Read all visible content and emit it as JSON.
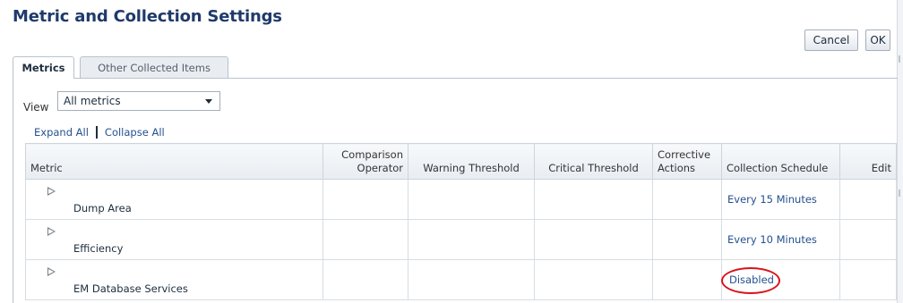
{
  "page": {
    "title": "Metric and Collection Settings"
  },
  "actions": {
    "cancel_label": "Cancel",
    "ok_label": "OK"
  },
  "tabs": [
    {
      "label": "Metrics",
      "selected": true
    },
    {
      "label": "Other Collected Items",
      "selected": false
    }
  ],
  "view": {
    "label": "View",
    "selected": "All metrics"
  },
  "links": {
    "expand_all": "Expand All",
    "collapse_all": "Collapse All"
  },
  "table": {
    "columns": {
      "metric": "Metric",
      "comparison_operator": "Comparison Operator",
      "warning_threshold": "Warning Threshold",
      "critical_threshold": "Critical Threshold",
      "corrective_actions": "Corrective Actions",
      "collection_schedule": "Collection Schedule",
      "edit": "Edit"
    },
    "rows": [
      {
        "metric": "Dump Area",
        "comparison_operator": "",
        "warning_threshold": "",
        "critical_threshold": "",
        "corrective_actions": "",
        "collection_schedule": "Every 15 Minutes",
        "edit": ""
      },
      {
        "metric": "Efficiency",
        "comparison_operator": "",
        "warning_threshold": "",
        "critical_threshold": "",
        "corrective_actions": "",
        "collection_schedule": "Every 10 Minutes",
        "edit": ""
      },
      {
        "metric": "EM Database Services",
        "comparison_operator": "",
        "warning_threshold": "",
        "critical_threshold": "",
        "corrective_actions": "",
        "collection_schedule": "Disabled",
        "edit": ""
      }
    ]
  },
  "colors": {
    "title": "#1f3a6b",
    "link": "#25508f",
    "highlight_circle": "#d8141b"
  }
}
